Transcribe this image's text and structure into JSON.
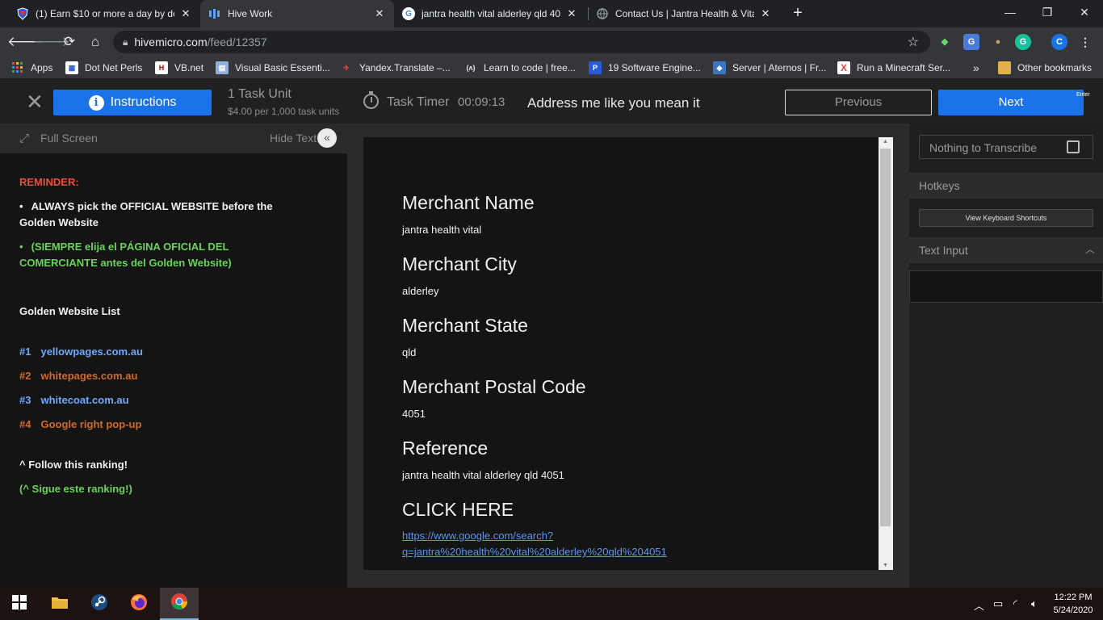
{
  "browser": {
    "tabs": [
      {
        "title": "(1) Earn $10 or more a day by do",
        "icon": "shield-icon"
      },
      {
        "title": "Hive Work",
        "icon": "hive-icon"
      },
      {
        "title": "jantra health vital alderley qld 40",
        "icon": "google-icon"
      },
      {
        "title": "Contact Us | Jantra Health & Vital",
        "icon": "globe-icon"
      }
    ],
    "url_host": "hivemicro.com",
    "url_path": "/feed/12357",
    "bookmarks": [
      "Apps",
      "Dot Net Perls",
      "VB.net",
      "Visual Basic Essenti...",
      "Yandex.Translate –...",
      "Learn to code | free...",
      "19 Software Engine...",
      "Server | Aternos | Fr...",
      "Run a Minecraft Ser..."
    ],
    "bookmarks_more": "»",
    "other_bookmarks": "Other bookmarks",
    "profile_initial": "C",
    "window_controls": {
      "minimize": "—",
      "maximize": "❐",
      "close": "✕"
    }
  },
  "topbar": {
    "close_glyph": "✕",
    "instructions_label": "Instructions",
    "task_unit": "1 Task Unit",
    "rate": "$4.00 per 1,000 task units",
    "timer_label": "Task Timer",
    "timer_value": "00:09:13",
    "task_title": "Address me like you mean it",
    "previous_label": "Previous",
    "next_label": "Next",
    "enter_key": "Enter"
  },
  "left_panel": {
    "full_screen": "Full Screen",
    "hide_text": "Hide Text",
    "hide_glyph": "«",
    "reminder": "REMINDER:",
    "bullet1": "ALWAYS pick the OFFICIAL WEBSITE before the Golden Website",
    "bullet2": "(SIEMPRE elija el PÁGINA OFICIAL DEL COMERCIANTE antes del Golden Website)",
    "golden_title": "Golden Website List",
    "golden": [
      {
        "num": "#1",
        "site": "yellowpages.com.au",
        "color": "#6ea8ff"
      },
      {
        "num": "#2",
        "site": "whitepages.com.au",
        "color": "#d06a2c"
      },
      {
        "num": "#3",
        "site": "whitecoat.com.au",
        "color": "#6ea8ff"
      },
      {
        "num": "#4",
        "site": "Google right pop-up",
        "color": "#d06a2c"
      }
    ],
    "follow": "^ Follow this ranking!",
    "follow_es": "(^ Sigue este ranking!)"
  },
  "merchant": {
    "name_label": "Merchant Name",
    "name": "jantra health vital",
    "city_label": "Merchant City",
    "city": "alderley",
    "state_label": "Merchant State",
    "state": "qld",
    "postal_label": "Merchant Postal Code",
    "postal": "4051",
    "reference_label": "Reference",
    "reference": "jantra health vital alderley qld 4051",
    "click_label": "CLICK HERE",
    "link_line1": "https://www.google.com/search?",
    "link_line2": "q=jantra%20health%20vital%20alderley%20qld%204051"
  },
  "right_panel": {
    "nothing_to_transcribe": "Nothing to Transcribe",
    "hotkeys": "Hotkeys",
    "view_shortcuts": "View Keyboard Shortcuts",
    "text_input": "Text Input"
  },
  "taskbar": {
    "time": "12:22 PM",
    "date": "5/24/2020"
  },
  "colors": {
    "accent": "#1a73e8",
    "reminder": "#e8503a",
    "spanish_green": "#6ad15c"
  }
}
